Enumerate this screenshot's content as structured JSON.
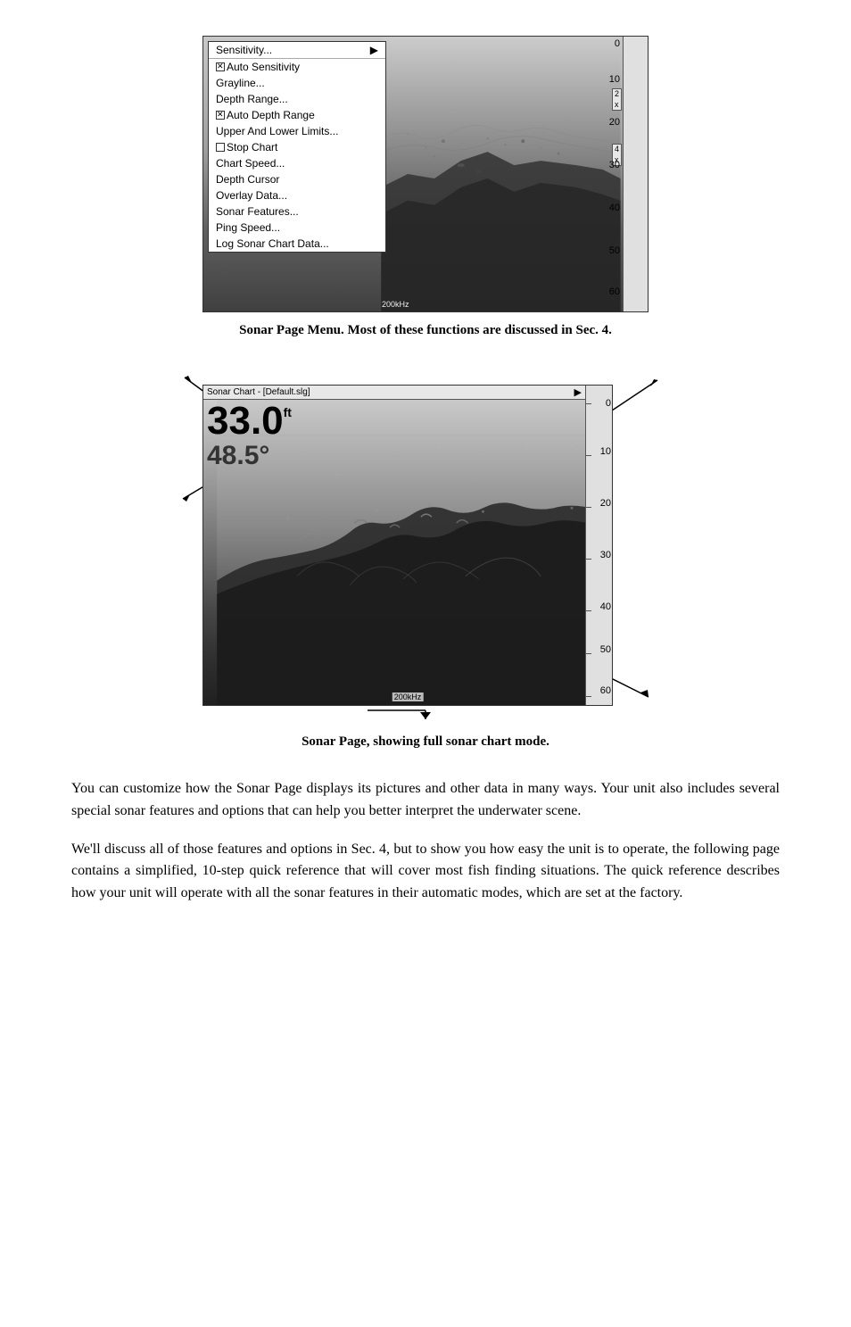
{
  "figure1": {
    "caption": "Sonar Page Menu. Most of these functions are discussed in Sec. 4.",
    "menu": {
      "items": [
        {
          "label": "Sensitivity...",
          "type": "arrow",
          "selected": false
        },
        {
          "label": "Auto Sensitivity",
          "type": "checkbox",
          "checked": true
        },
        {
          "label": "Grayline...",
          "type": "normal"
        },
        {
          "label": "Depth Range...",
          "type": "normal"
        },
        {
          "label": "Auto Depth Range",
          "type": "checkbox",
          "checked": true
        },
        {
          "label": "Upper And Lower Limits...",
          "type": "normal"
        },
        {
          "label": "Stop Chart",
          "type": "checkbox",
          "checked": false
        },
        {
          "label": "Chart Speed...",
          "type": "normal"
        },
        {
          "label": "Depth Cursor",
          "type": "normal"
        },
        {
          "label": "Overlay Data...",
          "type": "normal"
        },
        {
          "label": "Sonar Features...",
          "type": "normal"
        },
        {
          "label": "Ping Speed...",
          "type": "normal"
        },
        {
          "label": "Log Sonar Chart Data...",
          "type": "normal"
        }
      ]
    },
    "depthScale": [
      "0",
      "10",
      "2x",
      "20",
      "4x",
      "30",
      "40",
      "50",
      "60"
    ],
    "frequency": "200kHz"
  },
  "figure2": {
    "caption": "Sonar Page, showing full sonar chart mode.",
    "header": "Sonar Chart - [Default.slg]",
    "depthLarge": "33.0",
    "depthSmall": "48.5°",
    "depthUnit": "ft",
    "frequency": "200kHz",
    "depthScale": [
      "0",
      "10",
      "20",
      "30",
      "40",
      "50",
      "60"
    ]
  },
  "bodyText1": "You can customize how the Sonar Page displays its pictures and other data in many ways. Your unit also includes several special sonar features and options that can help you better interpret the underwater scene.",
  "bodyText2": "We'll discuss all of those features and options in Sec. 4, but to show you how easy the unit is to operate, the following page contains a simplified, 10-step quick reference that will cover most fish finding situations. The quick reference describes how your unit will operate with all the sonar features in their automatic modes, which are set at the factory."
}
